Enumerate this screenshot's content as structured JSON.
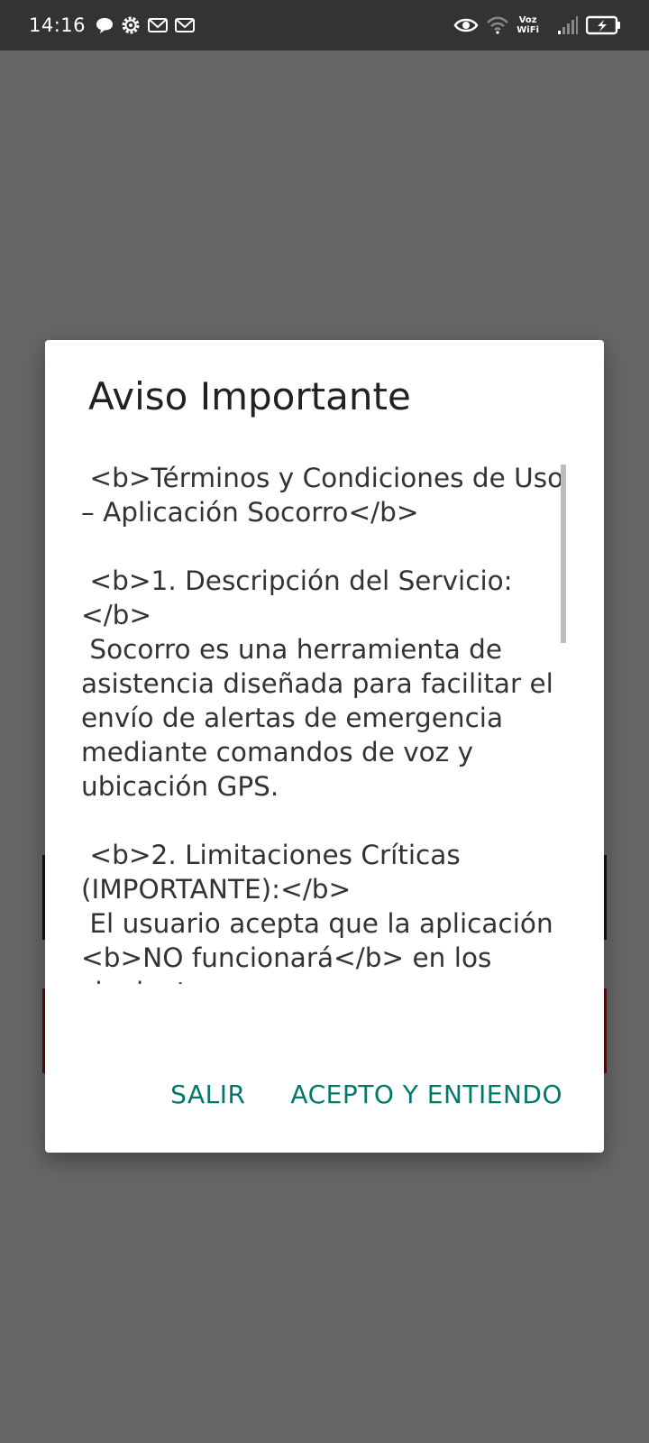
{
  "status_bar": {
    "time": "14:16",
    "voz_label": "Voz",
    "wifi_label": "WiFi",
    "icons_left": [
      "chat-bubble-icon",
      "gear-icon",
      "gmail-icon",
      "gmail-icon"
    ],
    "icons_right": [
      "eye-icon",
      "wifi-icon",
      "signal-icon",
      "battery-icon"
    ]
  },
  "dialog": {
    "title": "Aviso Importante",
    "body": " <b>Términos y Condiciones de Uso – Aplicación Socorro</b>\n\n <b>1. Descripción del Servicio:</b>\n Socorro es una herramienta de asistencia diseñada para facilitar el envío de alertas de emergencia mediante comandos de voz y ubicación GPS.\n\n <b>2. Limitaciones Críticas (IMPORTANTE):</b>\n El usuario acepta que la aplicación <b>NO funcionará</b> en los siguientes casos:",
    "buttons": {
      "exit": "SALIR",
      "accept": "ACEPTO Y ENTIENDO"
    }
  },
  "colors": {
    "status_bar_bg": "#333333",
    "scrim": "#666666",
    "dialog_bg": "#ffffff",
    "accent": "#00796b"
  }
}
